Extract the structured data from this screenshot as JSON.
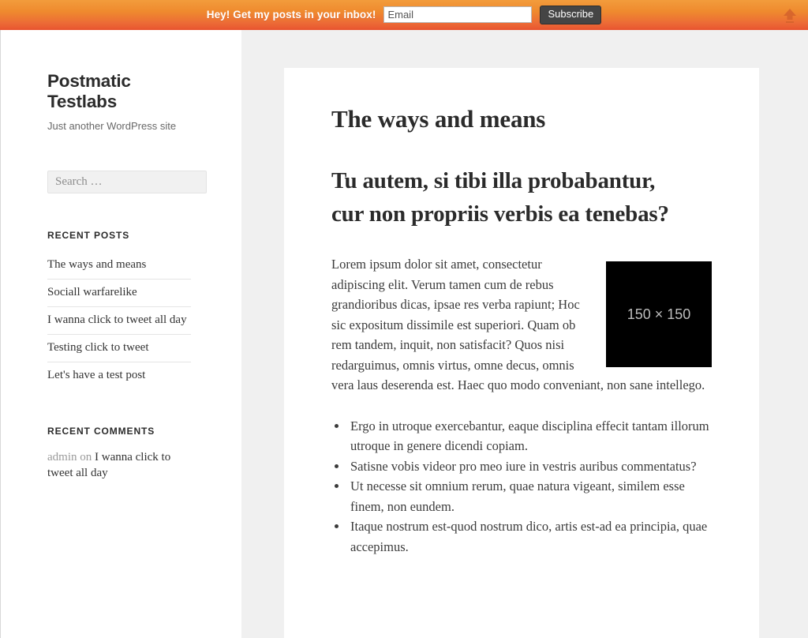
{
  "topbar": {
    "message": "Hey! Get my posts in your inbox!",
    "email_placeholder": "Email",
    "email_value": "",
    "subscribe_label": "Subscribe",
    "collapse_icon": "arrow-up-icon",
    "gradient_top": "#f29c3c",
    "gradient_bottom": "#e8532f"
  },
  "sidebar": {
    "site_title": "Postmatic Testlabs",
    "site_description": "Just another WordPress site",
    "search": {
      "placeholder": "Search …",
      "value": ""
    },
    "recent_posts": {
      "title": "RECENT POSTS",
      "items": [
        {
          "label": "The ways and means"
        },
        {
          "label": "Sociall warfarelike"
        },
        {
          "label": "I wanna click to tweet all day"
        },
        {
          "label": "Testing click to tweet"
        },
        {
          "label": "Let's have a test post"
        }
      ]
    },
    "recent_comments": {
      "title": "RECENT COMMENTS",
      "items": [
        {
          "author": "admin",
          "connector": " on ",
          "post": "I wanna click to tweet all day"
        }
      ]
    }
  },
  "main": {
    "entry_title": "The ways and means",
    "entry_subtitle": "Tu autem, si tibi illa probabantur, cur non propriis verbis ea tenebas?",
    "thumbnail_label": "150 × 150",
    "paragraph": "Lorem ipsum dolor sit amet, consectetur adipiscing elit. Verum tamen cum de rebus grandioribus dicas, ipsae res verba rapiunt; Hoc sic expositum dissimile est superiori. Quam ob rem tandem, inquit, non satisfacit? Quos nisi redarguimus, omnis virtus, omne decus, omnis vera laus deserenda est. Haec quo modo conveniant, non sane intellego.",
    "bullets": [
      "Ergo in utroque exercebantur, eaque disciplina effecit tantam illorum utroque in genere dicendi copiam.",
      "Satisne vobis videor pro meo iure in vestris auribus commentatus?",
      "Ut necesse sit omnium rerum, quae natura vigeant, similem esse finem, non eundem.",
      "Itaque nostrum est-quod nostrum dico, artis est-ad ea principia, quae accepimus."
    ]
  }
}
